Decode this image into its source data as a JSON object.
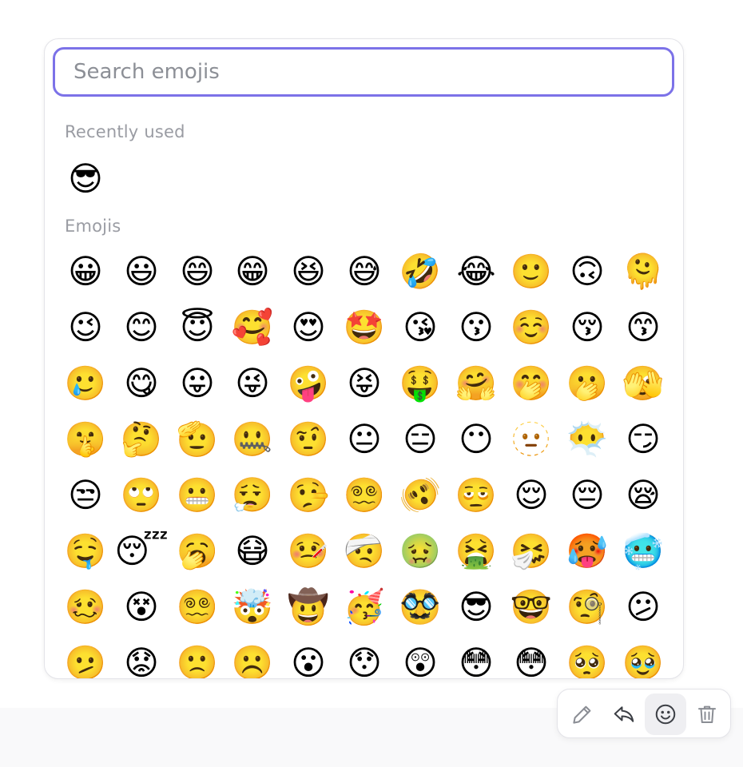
{
  "search": {
    "placeholder": "Search emojis",
    "value": ""
  },
  "sections": {
    "recent_label": "Recently used",
    "emojis_label": "Emojis"
  },
  "recent": [
    "😎"
  ],
  "emojis": [
    "😀",
    "😃",
    "😄",
    "😁",
    "😆",
    "😅",
    "🤣",
    "😂",
    "🙂",
    "🙃",
    "🫠",
    "😉",
    "😊",
    "😇",
    "🥰",
    "😍",
    "🤩",
    "😘",
    "😗",
    "☺️",
    "😚",
    "😙",
    "🥲",
    "😋",
    "😛",
    "😜",
    "🤪",
    "😝",
    "🤑",
    "🤗",
    "🤭",
    "🫢",
    "🫣",
    "🤫",
    "🤔",
    "🫡",
    "🤐",
    "🤨",
    "😐",
    "😑",
    "😶",
    "🫥",
    "😶‍🌫️",
    "😏",
    "😒",
    "🙄",
    "😬",
    "😮‍💨",
    "🤥",
    "😵‍💫",
    "🫨",
    "🫩",
    "😌",
    "😔",
    "😪",
    "🤤",
    "😴",
    "🥱",
    "😷",
    "🤒",
    "🤕",
    "🤢",
    "🤮",
    "🤧",
    "🥵",
    "🥶",
    "🥴",
    "😵",
    "😵‍💫",
    "🤯",
    "🤠",
    "🥳",
    "🥸",
    "😎",
    "🤓",
    "🧐",
    "😕",
    "🫤",
    "😟",
    "🙁",
    "☹️",
    "😮",
    "😯",
    "😲",
    "😳",
    "😳",
    "🥺",
    "🥹"
  ],
  "toolbar": {
    "edit": "pencil-icon",
    "reply": "reply-icon",
    "react": "smiley-icon",
    "delete": "trash-icon"
  },
  "colors": {
    "accent": "#7c72e8",
    "label": "#9a9ca3",
    "icon": "#8a8d94"
  }
}
